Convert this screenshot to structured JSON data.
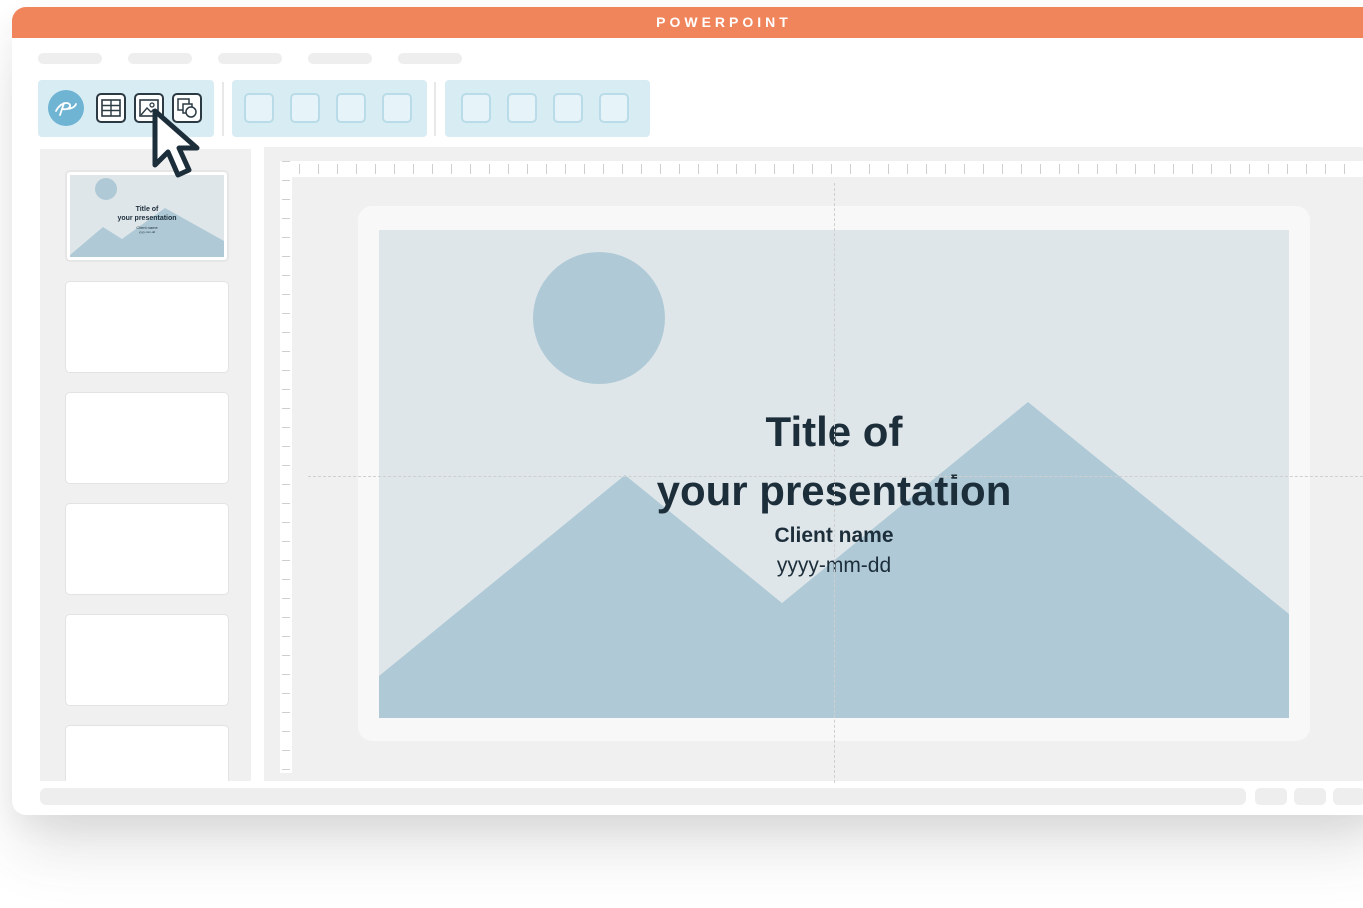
{
  "window": {
    "title": "POWERPOINT",
    "accent_color": "#f0845a"
  },
  "toolbar": {
    "group1": {
      "logo_icon": "presenter-logo-icon",
      "icons": [
        "table-grid-icon",
        "image-icon",
        "shapes-icon"
      ],
      "background": "#d8ecf3"
    },
    "group2_buttons": 4,
    "group3_buttons": 4
  },
  "slides_panel": {
    "thumbnails": [
      {
        "title_line1": "Title of",
        "title_line2": "your presentation",
        "subtitle": "Client name",
        "date": "yyyy-mm-dd",
        "selected": true
      },
      {
        "blank": true
      },
      {
        "blank": true
      },
      {
        "blank": true
      },
      {
        "blank": true
      },
      {
        "blank": true
      }
    ]
  },
  "slide": {
    "title_line1": "Title of",
    "title_line2": "your presentation",
    "client": "Client name",
    "date": "yyyy-mm-dd",
    "background_color": "#dfe6ea",
    "shape_color": "#afcad6",
    "text_color": "#1d2e3b"
  },
  "cursor": "arrow-cursor-icon"
}
